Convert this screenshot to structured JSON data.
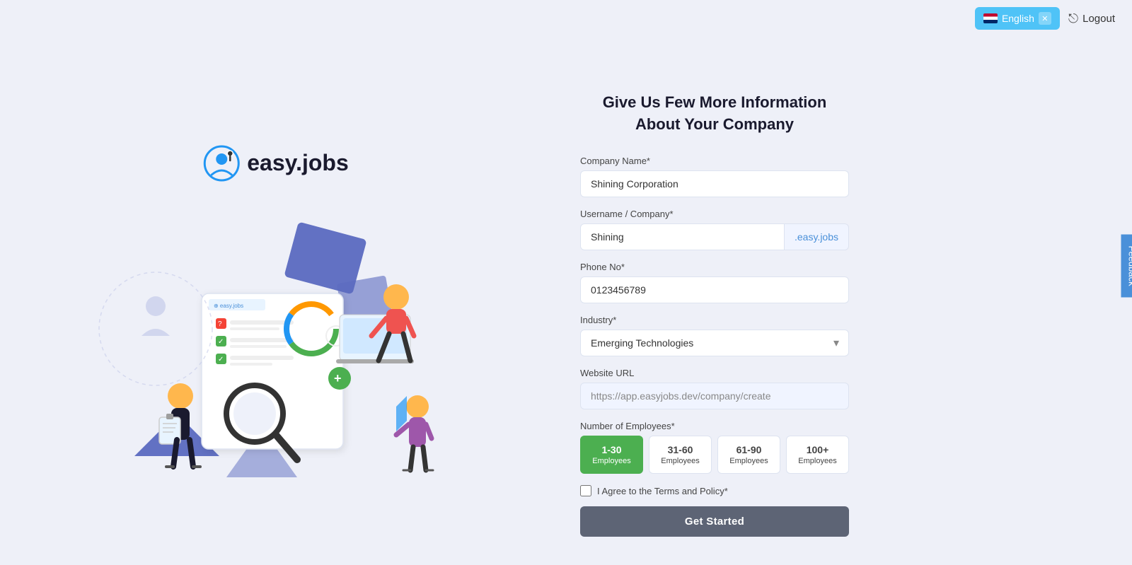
{
  "topbar": {
    "lang_label": "English",
    "logout_label": "Logout"
  },
  "logo": {
    "text": "easy.jobs"
  },
  "form": {
    "title": "Give Us Few More Information About Your Company",
    "company_name_label": "Company Name*",
    "company_name_value": "Shining Corporation",
    "username_label": "Username / Company*",
    "username_value": "Shining",
    "username_suffix": ".easy.jobs",
    "phone_label": "Phone No*",
    "phone_value": "0123456789",
    "industry_label": "Industry*",
    "industry_value": "Emerging Technologies",
    "website_label": "Website URL",
    "website_value": "https://app.easyjobs.dev/company/create",
    "employees_label": "Number of Employees*",
    "employee_options": [
      {
        "range": "1-30",
        "label": "Employees",
        "active": true
      },
      {
        "range": "31-60",
        "label": "Employees",
        "active": false
      },
      {
        "range": "61-90",
        "label": "Employees",
        "active": false
      },
      {
        "range": "100+",
        "label": "Employees",
        "active": false
      }
    ],
    "terms_text": "I Agree to the Terms and Policy*",
    "submit_label": "Get Started"
  },
  "feedback": {
    "label": "Feedback"
  }
}
